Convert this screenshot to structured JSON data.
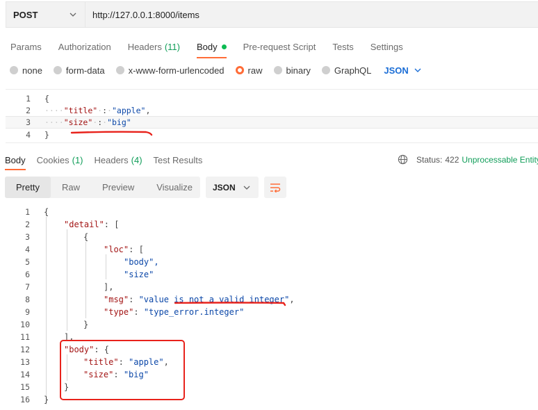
{
  "request": {
    "method": "POST",
    "url": "http://127.0.0.1:8000/items"
  },
  "request_tabs": [
    {
      "label": "Params"
    },
    {
      "label": "Authorization"
    },
    {
      "label": "Headers",
      "count": "(11)"
    },
    {
      "label": "Body",
      "active": true
    },
    {
      "label": "Pre-request Script"
    },
    {
      "label": "Tests"
    },
    {
      "label": "Settings"
    }
  ],
  "body_types": [
    {
      "label": "none"
    },
    {
      "label": "form-data"
    },
    {
      "label": "x-www-form-urlencoded"
    },
    {
      "label": "raw",
      "selected": true
    },
    {
      "label": "binary"
    },
    {
      "label": "GraphQL"
    }
  ],
  "body_format": "JSON",
  "request_body": {
    "line_numbers": [
      "1",
      "2",
      "3",
      "4"
    ],
    "open_brace": "{",
    "close_brace": "}",
    "title_key": "\"title\"",
    "title_value": "\"apple\"",
    "size_key": "\"size\"",
    "size_value": "\"big\""
  },
  "response_tabs": [
    {
      "label": "Body",
      "active": true
    },
    {
      "label": "Cookies",
      "count": "(1)"
    },
    {
      "label": "Headers",
      "count": "(4)"
    },
    {
      "label": "Test Results"
    }
  ],
  "status": {
    "label": "Status:",
    "code": "422",
    "text": "Unprocessable Entity"
  },
  "view_modes": [
    "Pretty",
    "Raw",
    "Preview",
    "Visualize"
  ],
  "response_format": "JSON",
  "response_body": {
    "line_numbers": [
      "1",
      "2",
      "3",
      "4",
      "5",
      "6",
      "7",
      "8",
      "9",
      "10",
      "11",
      "12",
      "13",
      "14",
      "15",
      "16"
    ],
    "l1": "{",
    "detail_key": "\"detail\"",
    "l2_tail": ": [",
    "l3": "{",
    "loc_key": "\"loc\"",
    "l4_tail": ": [",
    "loc_0": "\"body\",",
    "loc_1": "\"size\"",
    "l7": "],",
    "msg_key": "\"msg\"",
    "msg_value": "\"value is not a valid integer\"",
    "type_key": "\"type\"",
    "type_value": "\"type_error.integer\"",
    "l10": "}",
    "l11": "],",
    "body_key": "\"body\"",
    "l12_tail": ": {",
    "title_key": "\"title\"",
    "title_value": "\"apple\"",
    "size_key": "\"size\"",
    "size_value": "\"big\"",
    "l15": "}",
    "l16": "}"
  },
  "colors": {
    "accent": "#ff6c37",
    "success": "#0f9d58",
    "annotation": "#e8221b",
    "json_key": "#a31515",
    "json_string": "#0b47a8"
  }
}
